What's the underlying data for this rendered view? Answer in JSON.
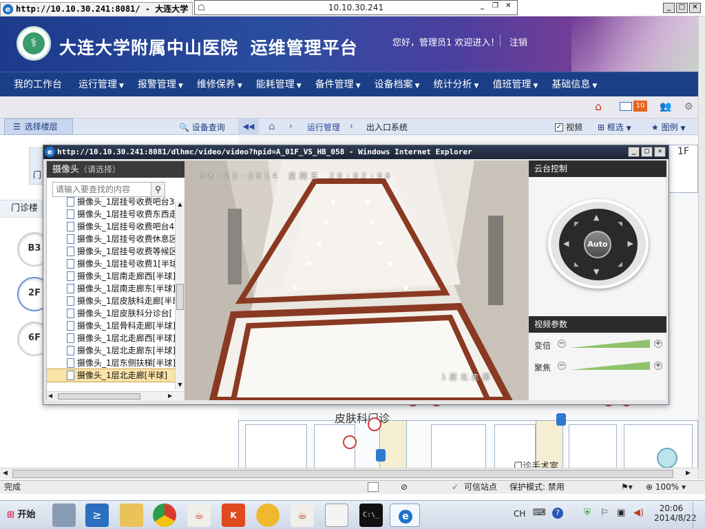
{
  "ie": {
    "tab_title": "http://10.10.30.241:8081/ - 大连大学",
    "page_address": "10.10.30.241"
  },
  "header": {
    "hospital_name": "大连大学附属中山医院",
    "platform_name": "运维管理平台",
    "greeting": "您好，管理员1 欢迎进入！",
    "logout": "注销"
  },
  "nav": {
    "items": [
      "我的工作台",
      "运行管理",
      "报警管理",
      "维修保养",
      "能耗管理",
      "备件管理",
      "设备档案",
      "统计分析",
      "值班管理",
      "基础信息"
    ]
  },
  "toolbar": {
    "mail_count": "10"
  },
  "subbar": {
    "select_floor": "选择楼层",
    "device_query": "设备查询",
    "crumb1": "运行管理",
    "crumb2": "出入口系统",
    "video_label": "视频",
    "box_select": "框选",
    "legend": "图例"
  },
  "leftpane": {
    "building_label": "门诊楼",
    "building_tab": "门",
    "floors": [
      "B3",
      "2F",
      "6F"
    ]
  },
  "map": {
    "label_top_right": "1F",
    "dept_label": "皮肤科门诊",
    "bottom_label": "门诊手术室"
  },
  "popup": {
    "title": "http://10.10.30.241:8081/dlhmc/video/video?hpid=A_01F_VS_HB_058 - Windows Internet Explorer",
    "cam_header": "摄像头",
    "cam_header_hint": "（请选择）",
    "search_placeholder": "请输入要查找的内容",
    "cameras": [
      "摄像头_1层挂号收费吧台3",
      "摄像头_1层挂号收费东西走",
      "摄像头_1层挂号收费吧台4",
      "摄像头_1层挂号收费休息区",
      "摄像头_1层挂号收费等候区",
      "摄像头_1层挂号收费1[半球",
      "摄像头_1层南走廊西[半球]",
      "摄像头_1层南走廊东[半球]",
      "摄像头_1层皮肤科走廊[半球",
      "摄像头_1层皮肤科分诊台[",
      "摄像头_1层骨科走廊[半球]",
      "摄像头_1层北走廊西[半球]",
      "摄像头_1层北走廊东[半球]",
      "摄像头_1层东侧扶梯[半球]",
      "摄像头_1层北走廊[半球]"
    ],
    "active_index": 14,
    "video_timestamp": "08-22-2014 星期五 20:02:06",
    "video_caption": "1层北走廊",
    "ptz_header": "云台控制",
    "ptz_auto": "Auto",
    "params_header": "视频参数",
    "zoom_label": "变倍",
    "focus_label": "聚焦"
  },
  "statusbar": {
    "done": "完成",
    "trusted": "可信站点",
    "protected_mode": "保护模式: 禁用",
    "zoom": "100%"
  },
  "taskbar": {
    "start": "开始",
    "lang": "CH",
    "time": "20:06",
    "date": "2014/8/22"
  },
  "colors": {
    "nav_bg": "#1b3f86",
    "header_start": "#1d3a8c",
    "header_end": "#7a3d96",
    "popup_title_bg": "#1b2436",
    "active_item_bg": "#fbe4a8"
  }
}
